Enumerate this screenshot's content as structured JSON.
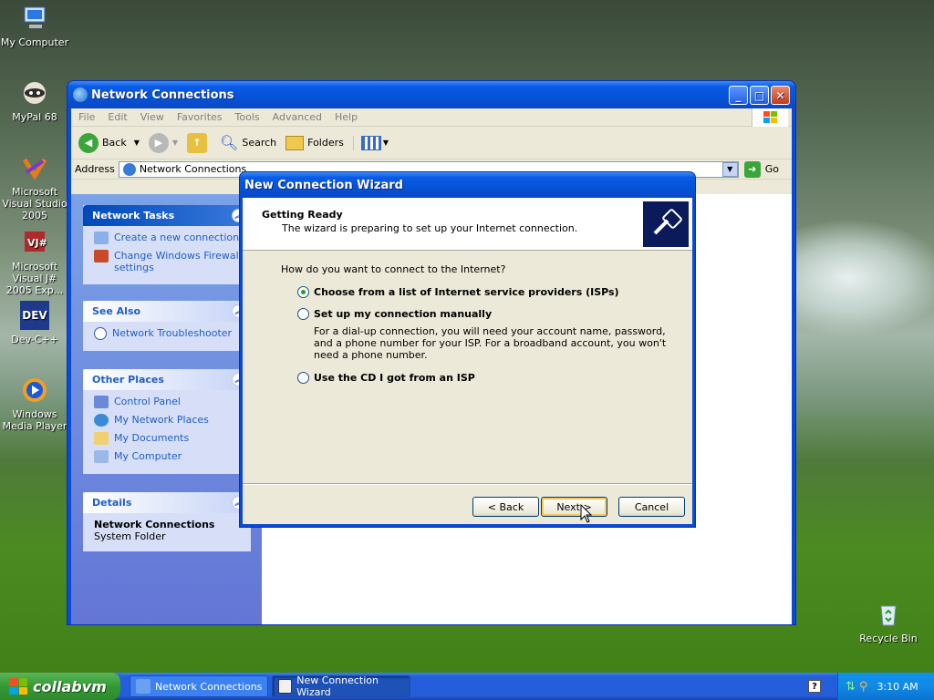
{
  "desktop": {
    "icons": [
      {
        "label": "My Computer"
      },
      {
        "label": "MyPal 68"
      },
      {
        "label": "Microsoft Visual Studio 2005"
      },
      {
        "label": "Microsoft Visual J# 2005 Exp..."
      },
      {
        "label": "Dev-C++",
        "glyph": "DEV"
      },
      {
        "label": "Windows Media Player"
      },
      {
        "label": "Recycle Bin"
      }
    ]
  },
  "explorer": {
    "title": "Network Connections",
    "menu": [
      "File",
      "Edit",
      "View",
      "Favorites",
      "Tools",
      "Advanced",
      "Help"
    ],
    "toolbar": {
      "back": "Back",
      "search": "Search",
      "folders": "Folders"
    },
    "address": {
      "label": "Address",
      "value": "Network Connections",
      "go": "Go"
    },
    "panels": {
      "network_tasks": {
        "title": "Network Tasks",
        "items": [
          "Create a new connection",
          "Change Windows Firewall settings"
        ]
      },
      "see_also": {
        "title": "See Also",
        "items": [
          "Network Troubleshooter"
        ]
      },
      "other_places": {
        "title": "Other Places",
        "items": [
          "Control Panel",
          "My Network Places",
          "My Documents",
          "My Computer"
        ]
      },
      "details": {
        "title": "Details",
        "name": "Network Connections",
        "type": "System Folder"
      }
    }
  },
  "wizard": {
    "title": "New Connection Wizard",
    "heading": "Getting Ready",
    "subheading": "The wizard is preparing to set up your Internet connection.",
    "question": "How do you want to connect to the Internet?",
    "options": [
      {
        "label": "Choose from a list of Internet service providers (ISPs)",
        "selected": true
      },
      {
        "label": "Set up my connection manually",
        "selected": false
      },
      {
        "label": "Use the CD I got from an ISP",
        "selected": false
      }
    ],
    "manual_description": "For a dial-up connection, you will need your account name, password, and a phone number for your ISP. For a broadband account, you won't need a phone number.",
    "buttons": {
      "back": "< Back",
      "next": "Next >",
      "cancel": "Cancel"
    }
  },
  "taskbar": {
    "start": "collabvm",
    "tasks": [
      "Network Connections",
      "New Connection Wizard"
    ],
    "clock": "3:10 AM",
    "help": "?"
  },
  "colors": {
    "xp_blue": "#0a4ad8",
    "taskbar": "#245edb",
    "start_green": "#339933",
    "link_blue": "#215dc6"
  }
}
